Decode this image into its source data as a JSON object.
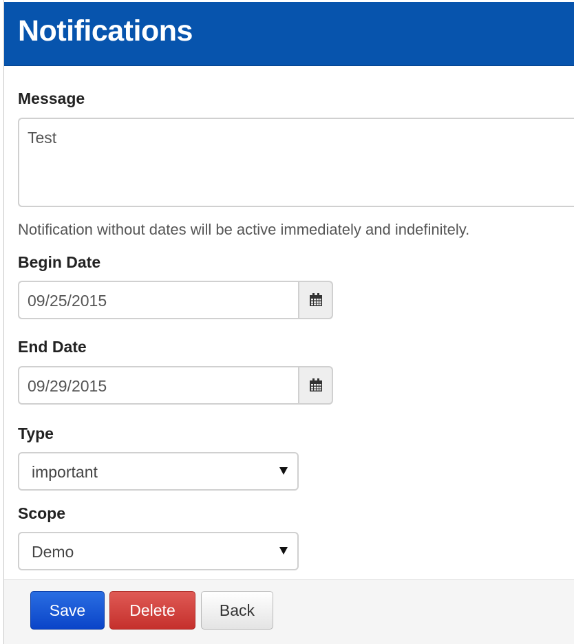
{
  "header": {
    "title": "Notifications"
  },
  "form": {
    "message_label": "Message",
    "message_value": "Test",
    "help_text": "Notification without dates will be active immediately and indefinitely.",
    "begin_date_label": "Begin Date",
    "begin_date_value": "09/25/2015",
    "end_date_label": "End Date",
    "end_date_value": "09/29/2015",
    "type_label": "Type",
    "type_value": "important",
    "scope_label": "Scope",
    "scope_value": "Demo"
  },
  "actions": {
    "save_label": "Save",
    "delete_label": "Delete",
    "back_label": "Back"
  },
  "icons": {
    "calendar": "calendar-icon",
    "dropdown": "chevron-down-icon"
  },
  "colors": {
    "header": "#0754ad",
    "save": "#0a44c8",
    "delete": "#c5302c"
  }
}
